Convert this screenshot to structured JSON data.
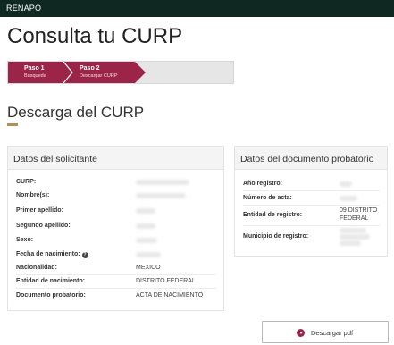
{
  "header": {
    "brand": "RENAPO"
  },
  "page_title": "Consulta tu CURP",
  "stepper": {
    "steps": [
      {
        "title": "Paso 1",
        "subtitle": "Búsqueda"
      },
      {
        "title": "Paso 2",
        "subtitle": "Descargar CURP"
      }
    ]
  },
  "section_title": "Descarga del CURP",
  "solicitante": {
    "title": "Datos del solicitante",
    "rows": [
      {
        "label": "CURP:",
        "value": ""
      },
      {
        "label": "Nombre(s):",
        "value": ""
      },
      {
        "label": "Primer apellido:",
        "value": ""
      },
      {
        "label": "Segundo apellido:",
        "value": ""
      },
      {
        "label": "Sexo:",
        "value": ""
      },
      {
        "label": "Fecha de nacimiento:",
        "value": ""
      },
      {
        "label": "Nacionalidad:",
        "value": "MEXICO"
      },
      {
        "label": "Entidad de nacimiento:",
        "value": "DISTRITO FEDERAL"
      },
      {
        "label": "Documento probatorio:",
        "value": "ACTA DE NACIMIENTO"
      }
    ]
  },
  "documento": {
    "title": "Datos del documento probatorio",
    "rows": [
      {
        "label": "Año registro:",
        "value": ""
      },
      {
        "label": "Número de acta:",
        "value": ""
      },
      {
        "label": "Entidad de registro:",
        "value_line1": "09 DISTRITO",
        "value_line2": "FEDERAL"
      },
      {
        "label": "Municipio de registro:",
        "value": ""
      }
    ]
  },
  "download": {
    "label": "Descargar pdf",
    "icon": "download-icon"
  },
  "colors": {
    "topbar": "#0f2922",
    "accent": "#9d2449",
    "gold": "#b38e5d"
  }
}
